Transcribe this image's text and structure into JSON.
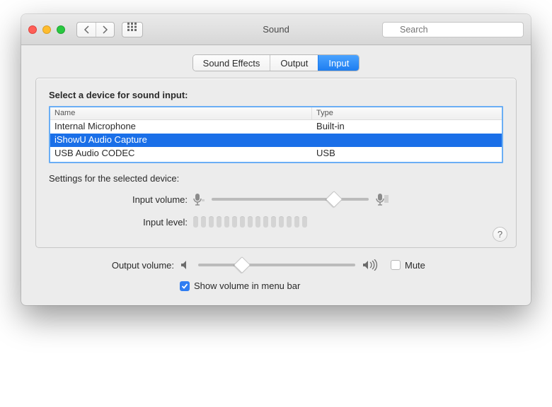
{
  "window": {
    "title": "Sound"
  },
  "search": {
    "placeholder": "Search"
  },
  "tabs": {
    "items": [
      {
        "label": "Sound Effects"
      },
      {
        "label": "Output"
      },
      {
        "label": "Input"
      }
    ],
    "active": 2
  },
  "panel": {
    "title": "Select a device for sound input:",
    "columns": {
      "name": "Name",
      "type": "Type"
    },
    "devices": [
      {
        "name": "Internal Microphone",
        "type": "Built-in",
        "selected": false
      },
      {
        "name": "iShowU Audio Capture",
        "type": "",
        "selected": true
      },
      {
        "name": "USB Audio CODEC",
        "type": "USB",
        "selected": false
      }
    ],
    "settings_label": "Settings for the selected device:",
    "input_volume_label": "Input volume:",
    "input_level_label": "Input level:",
    "input_volume_percent": 78
  },
  "output": {
    "label": "Output volume:",
    "percent": 28,
    "mute_label": "Mute",
    "mute_checked": false,
    "show_menubar_label": "Show volume in menu bar",
    "show_menubar_checked": true
  }
}
